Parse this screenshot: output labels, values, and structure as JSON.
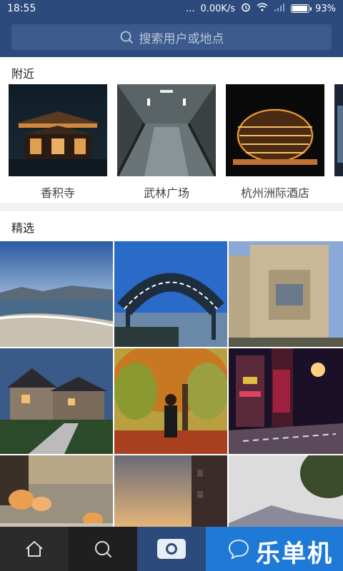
{
  "status_bar": {
    "time": "18:55",
    "dots": "...",
    "speed": "0.00K/s",
    "battery_percent": "93%",
    "battery_level": 0.93,
    "icons": [
      "alarm-icon",
      "wifi-icon",
      "signal-icon",
      "battery-icon"
    ]
  },
  "search": {
    "placeholder": "搜索用户或地点",
    "icon": "search-icon"
  },
  "nearby": {
    "title": "附近",
    "places": [
      {
        "label": "香积寺"
      },
      {
        "label": "武林广场"
      },
      {
        "label": "杭州洲际酒店"
      }
    ]
  },
  "featured": {
    "title": "精选",
    "photos": 9
  },
  "bottom_nav": {
    "items": [
      "home-icon",
      "search-icon",
      "camera-icon",
      "chat-icon"
    ],
    "watermark": "乐单机"
  },
  "colors": {
    "header": "#2d4a7c",
    "search_box": "#3d5a8c",
    "chat_tab": "#1e7ad6"
  }
}
